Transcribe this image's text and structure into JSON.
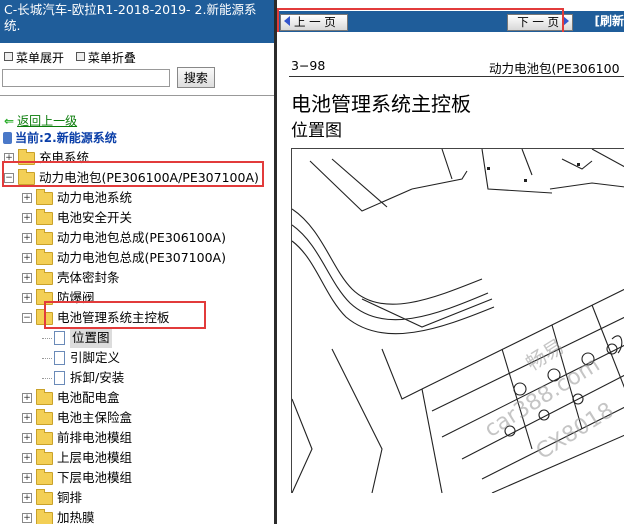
{
  "left_panel": {
    "title": "C-长城汽车-欧拉R1-2018-2019- 2.新能源系统.",
    "expand_label": "菜单展开",
    "collapse_label": "菜单折叠",
    "search_placeholder": "",
    "search_button": "搜索",
    "back_link": "返回上一级",
    "current_label": "当前:2.新能源系统"
  },
  "tree": [
    {
      "label": "充电系统",
      "type": "folder",
      "level": 0,
      "state": "plus"
    },
    {
      "label": "动力电池包(PE306100A/PE307100A)",
      "type": "folder",
      "level": 0,
      "state": "minus",
      "highlight": true
    },
    {
      "label": "动力电池系统",
      "type": "folder",
      "level": 1,
      "state": "plus"
    },
    {
      "label": "电池安全开关",
      "type": "folder",
      "level": 1,
      "state": "plus"
    },
    {
      "label": "动力电池包总成(PE306100A)",
      "type": "folder",
      "level": 1,
      "state": "plus"
    },
    {
      "label": "动力电池包总成(PE307100A)",
      "type": "folder",
      "level": 1,
      "state": "plus"
    },
    {
      "label": "壳体密封条",
      "type": "folder",
      "level": 1,
      "state": "plus"
    },
    {
      "label": "防爆阀",
      "type": "folder",
      "level": 1,
      "state": "plus"
    },
    {
      "label": "电池管理系统主控板",
      "type": "folder",
      "level": 1,
      "state": "minus",
      "highlight": true
    },
    {
      "label": "位置图",
      "type": "doc",
      "level": 2,
      "selected": true
    },
    {
      "label": "引脚定义",
      "type": "doc",
      "level": 2
    },
    {
      "label": "拆卸/安装",
      "type": "doc",
      "level": 2
    },
    {
      "label": "电池配电盒",
      "type": "folder",
      "level": 1,
      "state": "plus"
    },
    {
      "label": "电池主保险盒",
      "type": "folder",
      "level": 1,
      "state": "plus"
    },
    {
      "label": "前排电池模组",
      "type": "folder",
      "level": 1,
      "state": "plus"
    },
    {
      "label": "上层电池模组",
      "type": "folder",
      "level": 1,
      "state": "plus"
    },
    {
      "label": "下层电池模组",
      "type": "folder",
      "level": 1,
      "state": "plus"
    },
    {
      "label": "铜排",
      "type": "folder",
      "level": 1,
      "state": "plus"
    },
    {
      "label": "加热膜",
      "type": "folder",
      "level": 1,
      "state": "plus"
    }
  ],
  "right_panel": {
    "prev_button": "上 一 页",
    "next_button": "下 一 页",
    "refresh_label": "[刷新",
    "page_number": "3−98",
    "page_header_right": "动力电池包(PE306100",
    "heading": "电池管理系统主控板",
    "subheading": "位置图",
    "watermark_1": "畅易",
    "watermark_2": "car388.com",
    "watermark_3": "CX8018"
  },
  "colors": {
    "header_blue": "#1f5d9a",
    "highlight_red": "#e23b3b",
    "link_green": "#0a7c0a",
    "current_blue": "#0b3fa8"
  }
}
